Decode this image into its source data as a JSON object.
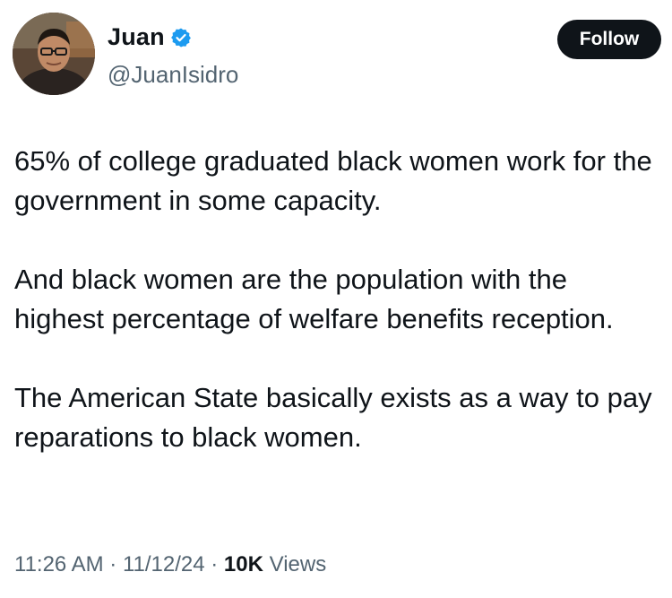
{
  "author": {
    "display_name": "Juan",
    "handle": "@JuanIsidro",
    "verified_icon": "verified-badge-icon",
    "verified_color": "#1d9bf0"
  },
  "follow_button": {
    "label": "Follow",
    "bg": "#0f1419",
    "fg": "#ffffff"
  },
  "tweet": {
    "paragraphs": [
      "65% of college graduated black women work for the government in some capacity.",
      "And black women are the population with the highest percentage of welfare benefits reception.",
      "The American State basically exists as a way to pay reparations to black women."
    ]
  },
  "meta": {
    "time": "11:26 AM",
    "separator": " · ",
    "date": "11/12/24",
    "views_count": "10K",
    "views_label": " Views"
  }
}
